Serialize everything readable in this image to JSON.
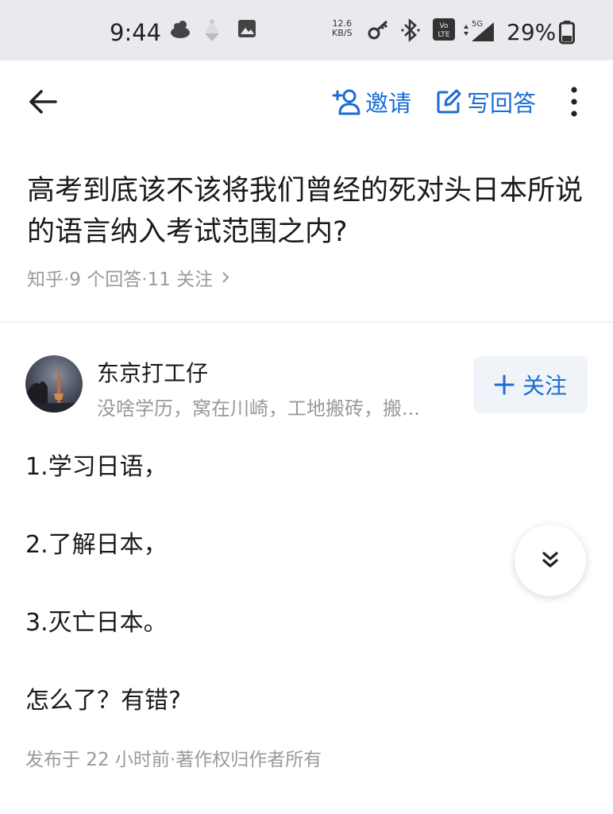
{
  "status_bar": {
    "time": "9:44",
    "net_speed_value": "12.6",
    "net_speed_unit": "KB/S",
    "volte_label": "Vo LTE",
    "network": "5G",
    "battery_percent": "29%",
    "icons": [
      "cloud-bowl-icon",
      "ice-cream-icon",
      "image-icon",
      "key-icon",
      "bluetooth-icon",
      "volte-icon",
      "signal-icon",
      "battery-icon"
    ]
  },
  "app_bar": {
    "invite_label": "邀请",
    "write_answer_label": "写回答",
    "accent_color": "#1a6dd6"
  },
  "question": {
    "title": "高考到底该不该将我们曾经的死对头日本所说的语言纳入考试范围之内?",
    "meta": "知乎·9 个回答·11 关注"
  },
  "answer": {
    "author_name": "东京打工仔",
    "author_bio": "没啥学历，窝在川崎，工地搬砖，搬...",
    "follow_label": "关注",
    "paragraphs": [
      "1.学习日语，",
      "2.了解日本，",
      "3.灭亡日本。",
      "怎么了？有错?"
    ],
    "footer": "发布于 22 小时前·著作权归作者所有"
  }
}
